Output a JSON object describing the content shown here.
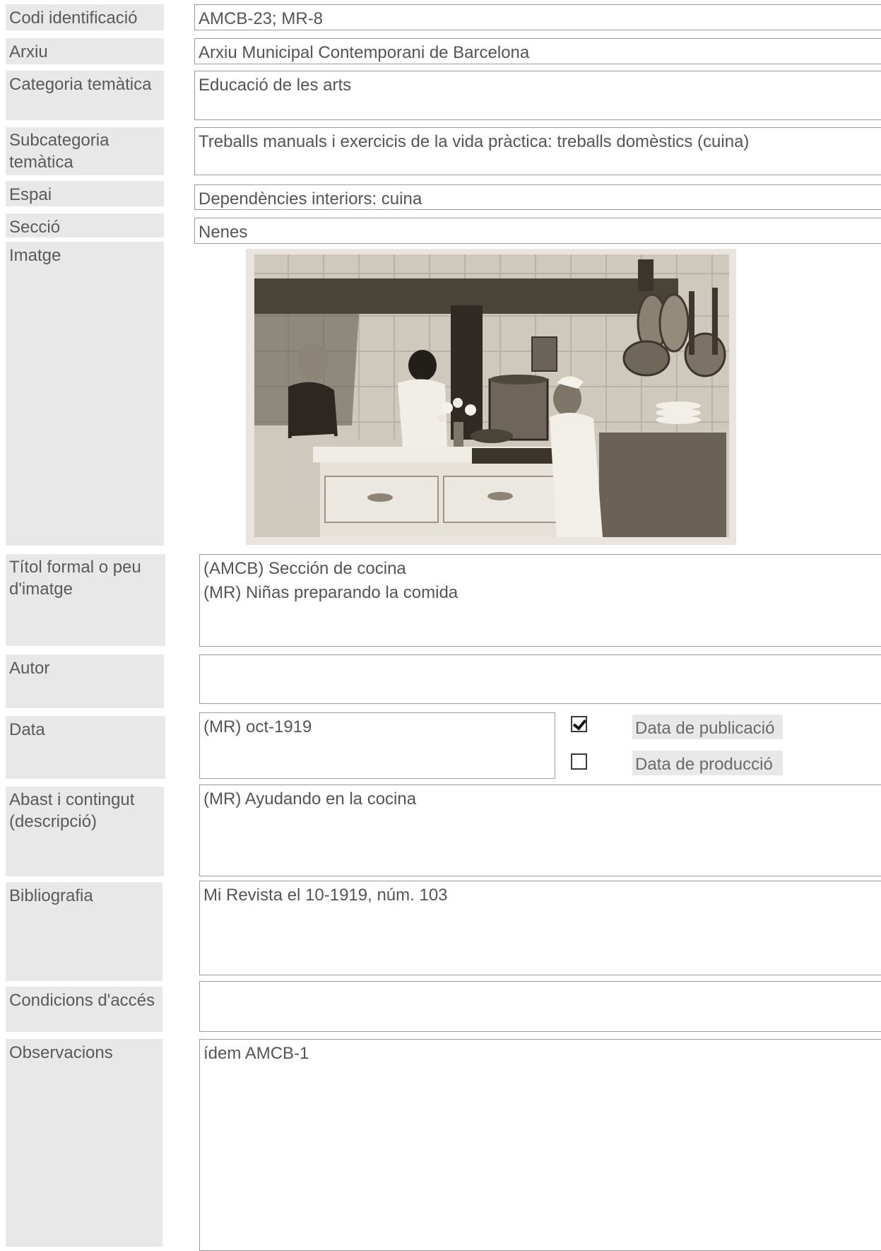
{
  "record": {
    "codi": {
      "label": "Codi identificació",
      "value": "AMCB-23; MR-8"
    },
    "arxiu": {
      "label": "Arxiu",
      "value": "Arxiu Municipal Contemporani de Barcelona"
    },
    "categoria": {
      "label": "Categoria temàtica",
      "value": "Educació de les arts"
    },
    "subcategoria": {
      "label": "Subcategoria\ntemàtica",
      "value": "Treballs manuals i exercicis de la vida pràctica: treballs domèstics (cuina)"
    },
    "espai": {
      "label": "Espai",
      "value": "Dependències interiors: cuina"
    },
    "seccio": {
      "label": "Secció",
      "value": "Nenes"
    },
    "imatge": {
      "label": "Imatge"
    },
    "titol": {
      "label": "Títol formal o peu d'imatge",
      "value": "(AMCB) Sección de cocina\n(MR) Niñas preparando la comida"
    },
    "autor": {
      "label": "Autor",
      "value": ""
    },
    "data": {
      "label": "Data",
      "value": "(MR) oct-1919",
      "publicacio": {
        "label": "Data de publicació",
        "checked": true
      },
      "produccio": {
        "label": "Data de producció",
        "checked": false
      }
    },
    "abast": {
      "label": "Abast i contingut (descripció)",
      "value": "(MR) Ayudando en la cocina"
    },
    "bibliografia": {
      "label": "Bibliografia",
      "value": "Mi Revista el 10-1919, núm. 103"
    },
    "condicions": {
      "label": "Condicions d'accés",
      "value": ""
    },
    "observacions": {
      "label": "Observacions",
      "value": "ídem AMCB-1"
    }
  },
  "colors": {
    "label_bg": "#e8e8e8",
    "field_border": "#9a9a9a",
    "text": "#555555"
  }
}
